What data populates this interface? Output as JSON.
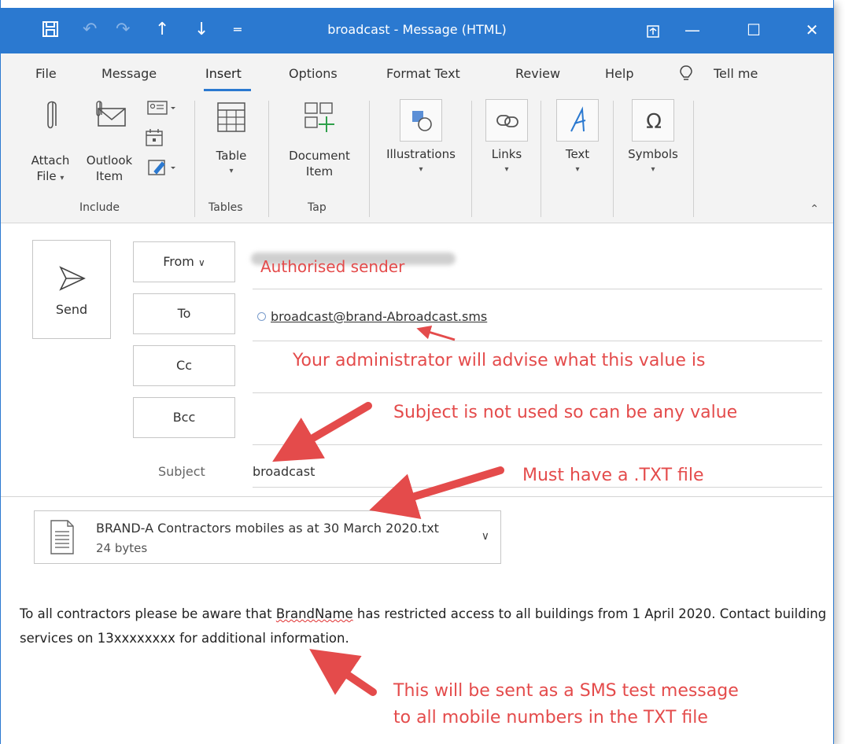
{
  "window": {
    "title": "broadcast - Message (HTML)",
    "accent_color": "#2b79d0",
    "quick_access": [
      "save-icon",
      "undo-icon",
      "redo-icon",
      "up-arrow-icon",
      "down-arrow-icon",
      "customize-icon"
    ],
    "controls": [
      "ribbon-display-icon",
      "minimize-icon",
      "maximize-icon",
      "close-icon"
    ]
  },
  "tabs": {
    "file": "File",
    "message": "Message",
    "insert": "Insert",
    "options": "Options",
    "format_text": "Format Text",
    "review": "Review",
    "help": "Help",
    "tell_me": "Tell me",
    "active": "Insert"
  },
  "ribbon": {
    "attach_file": [
      "Attach",
      "File"
    ],
    "outlook_item": [
      "Outlook",
      "Item"
    ],
    "table": "Table",
    "document_item": [
      "Document",
      "Item"
    ],
    "illustrations": "Illustrations",
    "links": "Links",
    "text": "Text",
    "symbols": "Symbols",
    "groups": {
      "include": "Include",
      "tables": "Tables",
      "tap": "Tap"
    }
  },
  "compose": {
    "send": "Send",
    "from_button": "From",
    "from_value": "Authorised sender",
    "to_button": "To",
    "to_value": "broadcast@brand-Abroadcast.sms",
    "cc_button": "Cc",
    "bcc_button": "Bcc",
    "subject_label": "Subject",
    "subject_value": "broadcast"
  },
  "attachment": {
    "name": "BRAND-A Contractors mobiles as at 30 March 2020.txt",
    "size": "24 bytes"
  },
  "body": {
    "part1": "To all contractors please be aware that ",
    "brand": "BrandName",
    "part2": " has restricted access to all buildings from 1 April 2020. Contact building services on 13xxxxxxxx for additional information."
  },
  "annotations": {
    "to_note": "Your administrator will advise what this value is",
    "subject_note": "Subject is not used so can be any value",
    "attach_note": "Must have a .TXT file",
    "body_note_1": "This will be sent as a SMS test message",
    "body_note_2": "to all mobile numbers in the TXT file",
    "color": "#e44b4b"
  }
}
